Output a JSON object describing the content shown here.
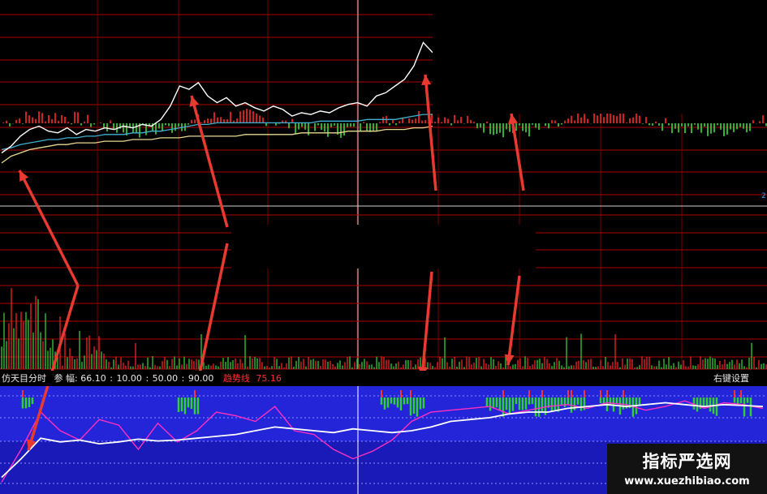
{
  "chart_data": [
    {
      "type": "line",
      "panel": "intraday price",
      "series": [
        {
          "color": "#ffffff",
          "values": [
            8,
            12,
            18,
            22,
            24,
            21,
            20,
            23,
            19,
            22,
            21,
            23,
            22,
            24,
            23,
            25,
            24,
            28,
            36,
            48,
            46,
            50,
            42,
            38,
            41,
            36,
            38,
            35,
            33,
            36,
            34,
            30,
            32,
            31,
            33,
            32,
            35,
            37,
            38,
            36,
            42,
            44,
            48,
            52,
            60,
            74,
            68
          ]
        },
        {
          "color": "#40b0d0",
          "values": [
            10,
            11,
            13,
            14,
            15,
            16,
            16,
            17,
            17,
            18,
            18,
            19,
            19,
            19,
            20,
            20,
            21,
            21,
            22,
            23,
            24,
            25,
            25,
            26,
            26,
            26,
            26,
            26,
            26,
            26,
            26,
            26,
            26,
            26,
            27,
            27,
            27,
            27,
            27,
            28,
            28,
            28,
            28,
            29,
            30,
            31,
            31
          ]
        },
        {
          "color": "#e8d890",
          "values": [
            2,
            6,
            8,
            10,
            11,
            12,
            13,
            13,
            14,
            14,
            14,
            15,
            15,
            15,
            16,
            16,
            16,
            17,
            17,
            17,
            18,
            18,
            18,
            18,
            18,
            18,
            19,
            19,
            19,
            19,
            19,
            19,
            20,
            20,
            20,
            20,
            20,
            21,
            21,
            21,
            21,
            22,
            22,
            22,
            23,
            23,
            24
          ]
        }
      ]
    },
    {
      "type": "bar",
      "panel": "volume"
    },
    {
      "type": "line",
      "panel": "indicator",
      "series": [
        {
          "color": "#ffffff",
          "values": [
            10,
            30,
            52,
            48,
            50,
            46,
            48,
            51,
            49,
            50,
            52,
            54,
            56,
            60,
            64,
            62,
            60,
            58,
            62,
            60,
            58,
            60,
            64,
            70,
            72,
            74,
            78,
            80,
            80,
            84,
            86,
            88,
            86,
            88,
            90,
            88,
            86,
            88,
            87,
            86
          ]
        },
        {
          "color": "#ff30c0",
          "values": [
            5,
            40,
            80,
            60,
            50,
            72,
            66,
            40,
            68,
            48,
            60,
            80,
            76,
            70,
            86,
            60,
            56,
            40,
            30,
            38,
            50,
            70,
            80,
            82,
            84,
            86,
            78,
            82,
            86,
            88,
            84,
            90,
            88,
            82,
            86,
            92,
            84,
            90,
            88,
            84
          ]
        }
      ],
      "params": [
        "66.10",
        "10.00",
        "50.00",
        "90.00"
      ]
    }
  ],
  "indicator_header": {
    "name": "仿天目分时",
    "param_label": "参",
    "param_label2": "幅",
    "values": [
      "66.10",
      "10.00",
      "50.00",
      "90.00"
    ],
    "trend_name": "趋势线",
    "trend_value": "75.16",
    "settings": "右键设置"
  },
  "watermark": {
    "cn": "指标严选网",
    "url": "www.xuezhibiao.com"
  },
  "right_tick": "2",
  "colors": {
    "grid": "#b00000",
    "up": "#d02020",
    "down": "#30b030",
    "blue_panel": "#2020d8",
    "arrow": "#e83a30"
  }
}
